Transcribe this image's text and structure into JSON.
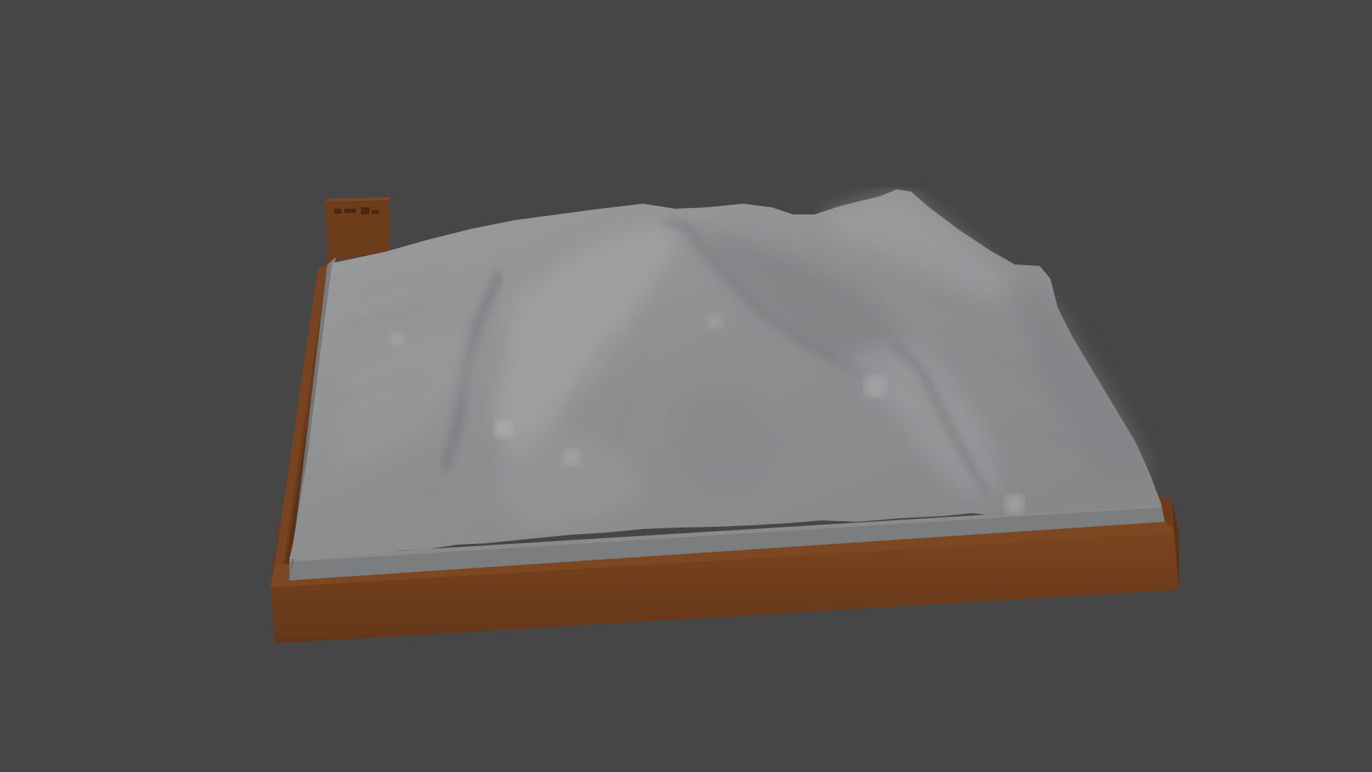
{
  "scene": {
    "background_color": "#464646",
    "subject": "terrain-relief-model",
    "base_color": "#6b3d1c",
    "base_shadow_color": "#4e2a12",
    "base_highlight_color": "#7a4722",
    "terrain_color": "#8f9092",
    "terrain_light_color": "#a6a7a9",
    "terrain_dark_color": "#6f7072",
    "terrain_side_color": "#7a7b7d"
  }
}
